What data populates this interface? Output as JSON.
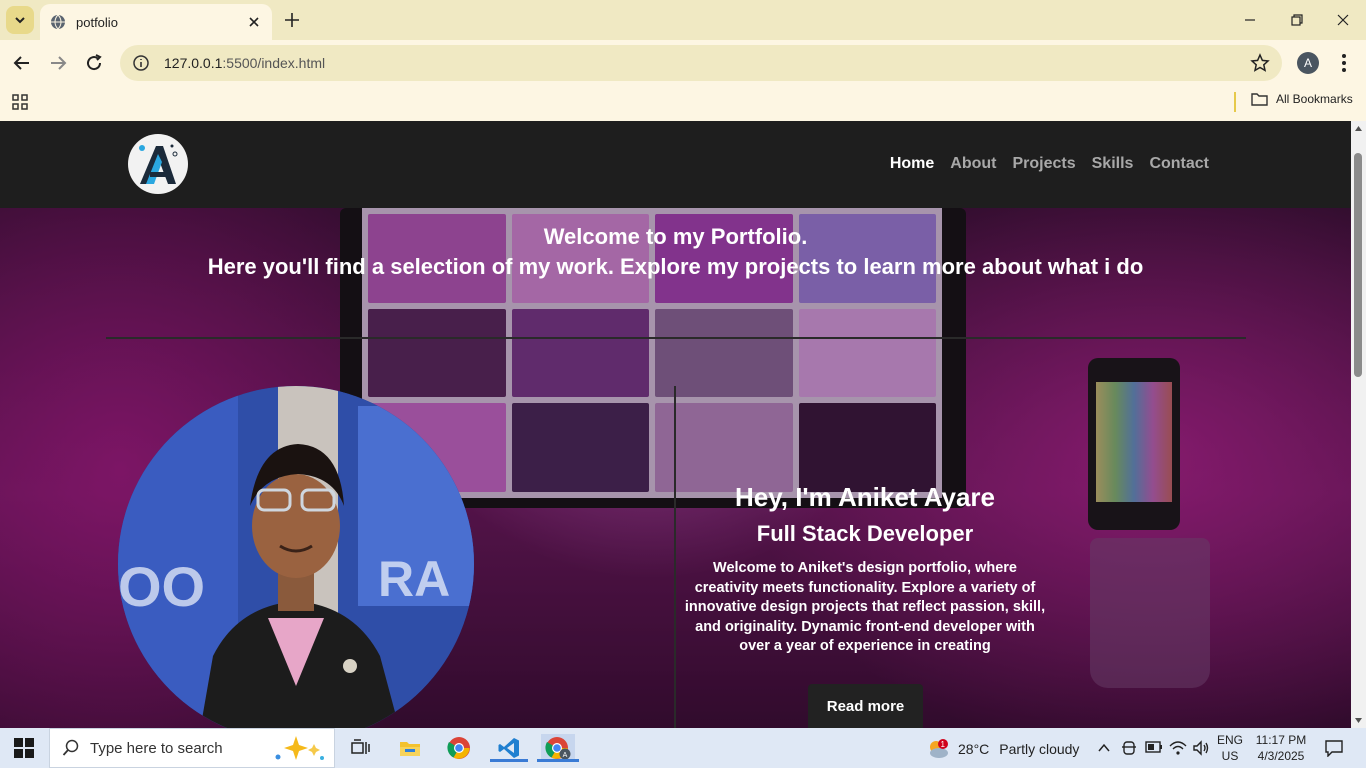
{
  "browser": {
    "tab_title": "potfolio",
    "url_host": "127.0.0.1",
    "url_rest": ":5500/index.html",
    "profile_initial": "A",
    "all_bookmarks": "All Bookmarks"
  },
  "site": {
    "nav": [
      "Home",
      "About",
      "Projects",
      "Skills",
      "Contact"
    ],
    "hero_line1": "Welcome to my Portfolio.",
    "hero_line2": "Here you'll find a selection of my work. Explore my projects to learn more about what i do",
    "intro_name": "Hey, I'm Aniket Ayare",
    "intro_role": "Full Stack Developer",
    "intro_text": "Welcome to Aniket's design portfolio, where creativity meets functionality. Explore a variety of innovative design projects that reflect passion, skill, and originality. Dynamic front-end developer with over a year of experience in creating",
    "read_more": "Read more"
  },
  "taskbar": {
    "search_placeholder": "Type here to search",
    "weather_temp": "28°C",
    "weather_desc": "Partly cloudy",
    "weather_badge": "1",
    "lang": "ENG",
    "region": "US",
    "time": "11:17 PM",
    "date": "4/3/2025"
  },
  "colors": {
    "chrome_bg": "#fdf6e3",
    "tabstrip_bg": "#f0e9c3",
    "site_nav_bg": "#1e1e1e",
    "accent_logo": "#2aa7e0"
  }
}
